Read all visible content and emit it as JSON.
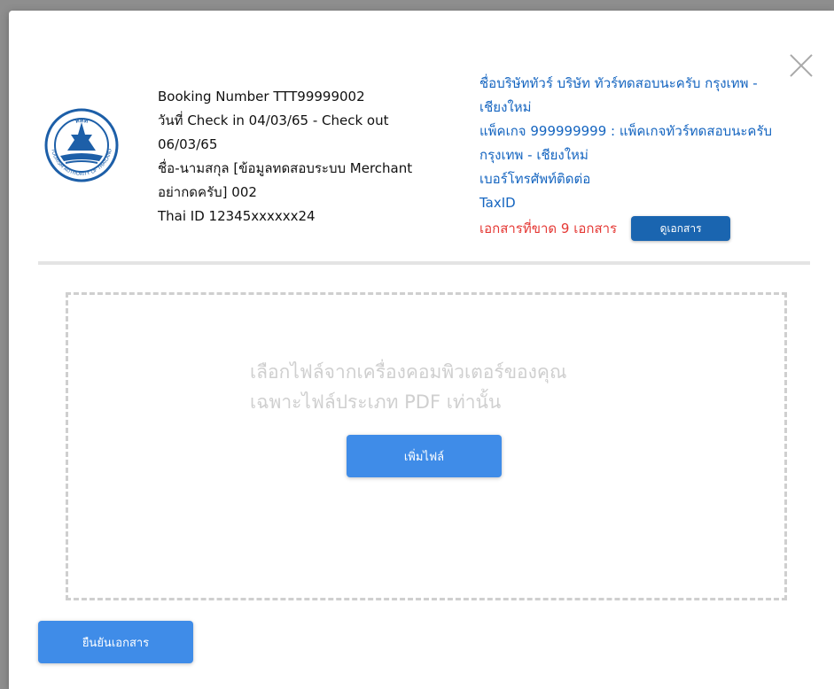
{
  "booking": {
    "number": "Booking Number TTT99999002",
    "checkin_line1": "วันที่ Check in 04/03/65 - Check out",
    "checkin_line2": "06/03/65",
    "name_line1": "ชื่อ-นามสกุล [ข้อมูลทดสอบระบบ Merchant",
    "name_line2": "อย่ากดครับ] 002",
    "thai_id": "Thai ID 12345xxxxxx24"
  },
  "company": {
    "name_line1": "ชื่อบริษัททัวร์ บริษัท ทัวร์ทดสอบนะครับ กรุงเทพ -",
    "name_line2": "เชียงใหม่",
    "package_line1": "แพ็คเกจ 999999999 : แพ็คเกจทัวร์ทดสอบนะครับ",
    "package_line2": "กรุงเทพ - เชียงใหม่",
    "phone": "เบอร์โทรศัพท์ติดต่อ",
    "tax_id": "TaxID",
    "missing_docs": "เอกสารที่ขาด 9 เอกสาร",
    "view_docs_label": "ดูเอกสาร"
  },
  "logo": {
    "text": "TOURISM AUTHORITY OF THAILAND",
    "top_text": "ททท"
  },
  "upload": {
    "line1": "เลือกไฟล์จากเครื่องคอมพิวเตอร์ของคุณ",
    "line2": "เฉพาะไฟล์ประเภท PDF เท่านั้น",
    "add_label": "เพิ่มไฟล์"
  },
  "footer": {
    "confirm_label": "ยืนยันเอกสาร"
  },
  "colors": {
    "primary": "#3f8ce8",
    "dark_blue": "#1a65b0",
    "link_blue": "#1565c0",
    "danger": "#e53935"
  }
}
